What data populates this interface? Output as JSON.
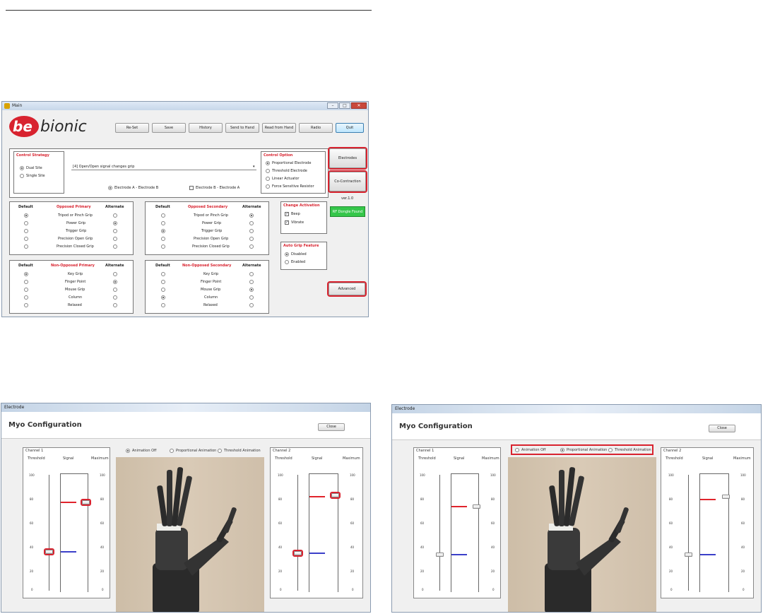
{
  "main_window": {
    "title": "Main",
    "logo": {
      "part1": "be",
      "part2": "bionic"
    },
    "toolbar": [
      "Re-Set",
      "Save",
      "History",
      "Send to Hand",
      "Read from Hand",
      "Radio",
      "Quit"
    ],
    "control_strategy": {
      "title": "Control Strategy",
      "options": [
        "Dual Site",
        "Single Site"
      ],
      "selected": 0
    },
    "combo_value": "[4] Open/Open signal changes grip",
    "electrode_choice": [
      "Electrode A - Electrode B",
      "Electrode B - Electrode A"
    ],
    "control_option": {
      "title": "Control Option",
      "options": [
        "Proportional Electrode",
        "Threshold Electrode",
        "Linear Actuator",
        "Force Sensitive Resistor"
      ],
      "selected": 0
    },
    "right_buttons": [
      "Electrodes",
      "Co-Contraction"
    ],
    "version": "ver.1.0",
    "rf_button": "RF Dongle Found",
    "change_activation": {
      "title": "Change Activation",
      "items": [
        "Beep",
        "Vibrate"
      ]
    },
    "auto_grip": {
      "title": "Auto Grip Feature",
      "options": [
        "Disabled",
        "Enabled"
      ],
      "selected": 0
    },
    "advanced_button": "Advanced",
    "col_default": "Default",
    "col_alternate": "Alternate",
    "opposed_primary": {
      "title": "Opposed Primary",
      "items": [
        "Tripod or Pinch Grip",
        "Power Grip",
        "Trigger Grip",
        "Precision Open Grip",
        "Precision Closed Grip"
      ]
    },
    "opposed_secondary": {
      "title": "Opposed Secondary",
      "items": [
        "Tripod or Pinch Grip",
        "Power Grip",
        "Trigger Grip",
        "Precision Open Grip",
        "Precision Closed Grip"
      ]
    },
    "non_opposed_primary": {
      "title": "Non-Opposed Primary",
      "items": [
        "Key Grip",
        "Finger Point",
        "Mouse Grip",
        "Column",
        "Relaxed"
      ]
    },
    "non_opposed_secondary": {
      "title": "Non-Opposed Secondary",
      "items": [
        "Key Grip",
        "Finger Point",
        "Mouse Grip",
        "Column",
        "Relaxed"
      ]
    }
  },
  "myo": {
    "window_title": "Electrode",
    "heading": "Myo Configuration",
    "close": "Close",
    "channel1": "Channel 1",
    "channel2": "Channel 2",
    "col_threshold": "Threshold",
    "col_signal": "Signal",
    "col_maximum": "Maximum",
    "animation": [
      "Animation Off",
      "Proportional Animation",
      "Threshold Animation"
    ],
    "ticks": [
      "100",
      "80",
      "60",
      "40",
      "20",
      "0"
    ]
  },
  "colors": {
    "accent_red": "#d8232f",
    "signal_red": "#e0242c",
    "signal_blue": "#3b3fc9",
    "green": "#35c64a"
  }
}
